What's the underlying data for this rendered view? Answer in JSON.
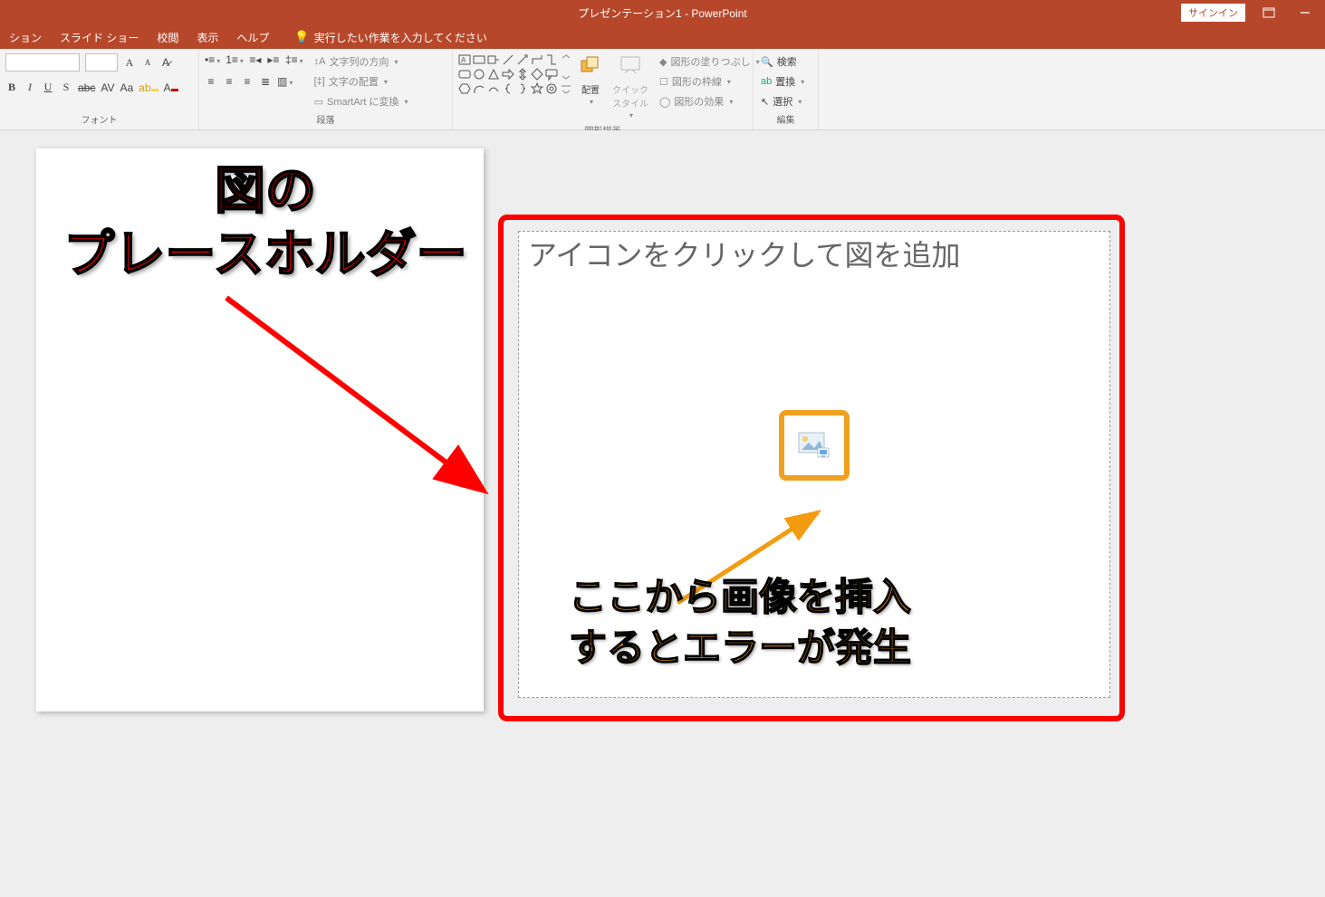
{
  "titlebar": {
    "title": "プレゼンテーション1 - PowerPoint",
    "signin": "サインイン"
  },
  "tabs": {
    "t1": "ション",
    "t2": "スライド ショー",
    "t3": "校閲",
    "t4": "表示",
    "t5": "ヘルプ",
    "tellme": "実行したい作業を入力してください"
  },
  "ribbon": {
    "font_label": "フォント",
    "para_label": "段落",
    "text_dir": "文字列の方向",
    "text_align": "文字の配置",
    "smartart": "SmartArt に変換",
    "arrange": "配置",
    "quick": "クイック\nスタイル",
    "shape_fill": "図形の塗りつぶし",
    "shape_outline": "図形の枠線",
    "shape_effects": "図形の効果",
    "drawing_label": "図形描画",
    "find": "検索",
    "replace": "置換",
    "select": "選択",
    "edit_label": "編集"
  },
  "annotations": {
    "red_title_l1": "図の",
    "red_title_l2": "プレースホルダー",
    "placeholder_text": "アイコンをクリックして図を追加",
    "orange_l1": "ここから画像を挿入",
    "orange_l2": "するとエラーが発生"
  }
}
